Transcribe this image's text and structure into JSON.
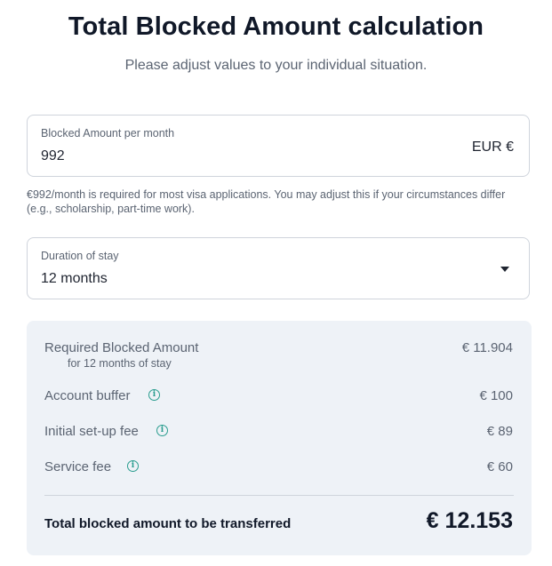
{
  "header": {
    "title": "Total Blocked Amount calculation",
    "subtitle": "Please adjust values to your individual situation."
  },
  "amount_field": {
    "label": "Blocked Amount per month",
    "value": "992",
    "suffix": "EUR €"
  },
  "helper_text": "€992/month is required for most visa applications. You may adjust this if your circumstances differ (e.g., scholarship, part-time work).",
  "duration_field": {
    "label": "Duration of stay",
    "value": "12 months"
  },
  "summary": {
    "required": {
      "label": "Required Blocked Amount",
      "sub": "for 12 months of stay",
      "value": "€ 11.904"
    },
    "buffer": {
      "label": "Account buffer",
      "value": "€ 100"
    },
    "setup": {
      "label": "Initial set-up fee",
      "value": "€ 89"
    },
    "service": {
      "label": "Service fee",
      "value": "€ 60"
    },
    "total": {
      "label": "Total blocked amount to be transferred",
      "value": "€ 12.153"
    }
  },
  "icons": {
    "info": "info-icon",
    "dropdown": "chevron-down-icon"
  },
  "colors": {
    "accent": "#2a9d8f",
    "panel": "#eef2f7"
  }
}
